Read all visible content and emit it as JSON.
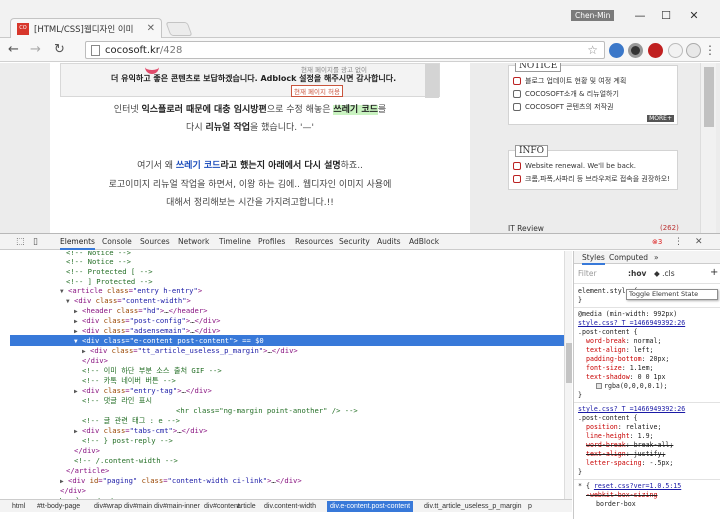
{
  "browser": {
    "tab_title": "[HTML/CSS]웹디자인 이미",
    "user_name": "Chen-Min",
    "url_domain": "cocosoft.kr",
    "url_path": "/428"
  },
  "page": {
    "ad_line1": "더 유익하고 좋은 콘텐츠로 보답하겠습니다. Adblock 설정을 해주시면 감사합니다.",
    "ad_line0": "현재 페이지를 광고 없이",
    "ad_button": "현재 페이지 허용",
    "para1_a": "인터넷 ",
    "para1_b": "익스플로러 때문에 대충 임시방편",
    "para1_c": "으로 수정 해놓은 ",
    "para1_d": "쓰레기 코드",
    "para1_e": "를",
    "para2_a": "다시 ",
    "para2_b": "리뉴얼 작업",
    "para2_c": "을 했습니다. '—'",
    "para3_a": "여기서 왜 ",
    "para3_b": "쓰레기 코드",
    "para3_c": "라고 했는지 아래에서 다시 설명",
    "para3_d": "하죠..",
    "para4": "로고이미지 리뉴얼 작업을 하면서, 이왕 하는 김에.. 웹디자인 이미지 사용에",
    "para5": "대해서 정리해보는 시간을 가지려고합니다.!!",
    "notice_title": "NOTICE",
    "notice_items": [
      "블로그 업데이트 현황 및 여정 계획",
      "COCOSOFT소개 & 리뉴얼하기",
      "COCOSOFT 콘텐츠의 저작권"
    ],
    "more_label": "MORE+",
    "info_title": "INFO",
    "info_items": [
      "Website renewal. We'll be back.",
      "크롬,파폭,사파리 등 브라우저로 접속을 권장하오!"
    ],
    "it_review": "IT Review",
    "it_count": "(262)"
  },
  "devtools": {
    "tabs": [
      "Elements",
      "Console",
      "Sources",
      "Network",
      "Timeline",
      "Profiles",
      "Resources",
      "Security",
      "Audits",
      "AdBlock"
    ],
    "error_count": "3",
    "dom_lines": [
      {
        "indent": 60,
        "html": "<span class='cmt'>&lt;!-- Notice --&gt;</span>"
      },
      {
        "indent": 66,
        "html": "<span class='cmt'>&lt;!-- Notice --&gt;</span>"
      },
      {
        "indent": 60,
        "html": "<span class='cmt'>&lt;!-- Protected [ --&gt;</span>"
      },
      {
        "indent": 60,
        "html": "<span class='cmt'>&lt;!-- ] Protected --&gt;</span>"
      }
    ],
    "breadcrumbs": [
      "html",
      "#tt-body-page",
      "div#wrap",
      "div#main",
      "div#main-inner",
      "div#content",
      "article",
      "div.content-width",
      "div.e-content.post-content",
      "div.tt_article_useless_p_margin",
      "p"
    ],
    "styles_tabs": [
      "Styles",
      "Computed"
    ],
    "filter_placeholder": "Filter",
    "hov_label": ":hov",
    "cls_label": ".cls",
    "tooltip": "Toggle Element State",
    "style_rules": {
      "element_style": "element.style {",
      "close": "}",
      "media": "@media (min-width: 992px)",
      "src1": "style.css?_T_=1466949392:26",
      "sel1": ".post-content {",
      "p1": "word-break",
      "v1": "normal;",
      "p2": "text-align",
      "v2": "left;",
      "p3": "padding-bottom",
      "v3": "20px;",
      "p4": "font-size",
      "v4": "1.1em;",
      "p5": "text-shadow",
      "v5": "0 0 1px",
      "v5b": "rgba(0,0,0,0.1);",
      "src2": "style.css?_T_=1466949392:26",
      "sel2": ".post-content {",
      "p6": "position",
      "v6": "relative;",
      "p7": "line-height",
      "v7": "1.9;",
      "p8": "word-break",
      "v8": "break-all;",
      "p9": "text-align",
      "v9": "justify;",
      "p10": "letter-spacing",
      "v10": "-.5px;",
      "sel3": "* {",
      "src3": "reset.css?ver=1.0.5:15",
      "p11": "-webkit-box-sizing",
      "v11": "",
      "p12": "border-box",
      "v12": ""
    }
  },
  "colors": {
    "selection": "#3879d9",
    "tag": "#881280",
    "attr": "#994500",
    "value": "#1a1aa6",
    "comment": "#236e25"
  }
}
